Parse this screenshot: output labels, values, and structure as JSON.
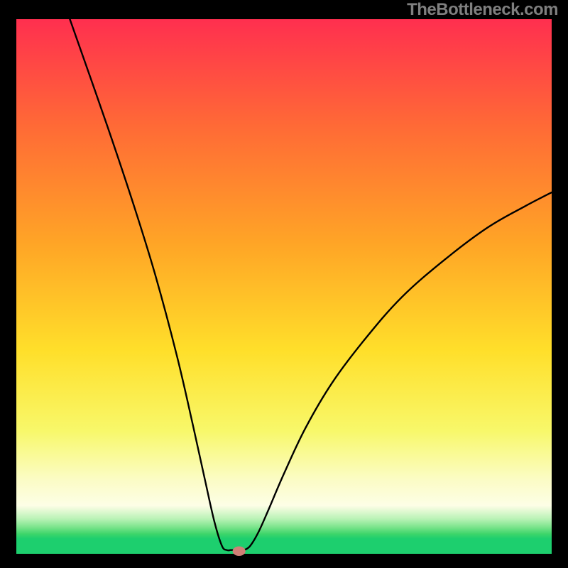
{
  "watermark": "TheBottleneck.com",
  "chart_data": {
    "type": "line",
    "title": "",
    "xlabel": "",
    "ylabel": "",
    "x_range": [
      0,
      100
    ],
    "y_range": [
      0,
      100
    ],
    "curve_left": {
      "x": [
        10,
        17,
        22,
        26,
        30,
        33,
        35.2,
        37,
        38.4,
        39.3,
        40
      ],
      "y": [
        100,
        80,
        65,
        52,
        37,
        24,
        14,
        6,
        1.5,
        0.7,
        0.7
      ]
    },
    "curve_right": {
      "x": [
        42.6,
        43.7,
        45.2,
        47,
        50,
        54,
        59,
        65,
        72,
        80,
        88,
        95,
        100
      ],
      "y": [
        0.7,
        1.5,
        4,
        8,
        15,
        23.5,
        32,
        40,
        48,
        55,
        61,
        65,
        67.6
      ]
    },
    "plateau": {
      "x1": 40,
      "x2": 42.6,
      "y": 0.7
    },
    "marker": {
      "x": 41.6,
      "y": 0.5,
      "rx": 1.2,
      "ry": 0.9,
      "color": "#d28077"
    },
    "gradient_stops": [
      {
        "offset": 0,
        "color": "#ff2f4f"
      },
      {
        "offset": 20,
        "color": "#ff6a36"
      },
      {
        "offset": 42,
        "color": "#ffa526"
      },
      {
        "offset": 62,
        "color": "#ffdf2a"
      },
      {
        "offset": 77,
        "color": "#f8f86a"
      },
      {
        "offset": 86,
        "color": "#fbfcc4"
      },
      {
        "offset": 91,
        "color": "#fdfee6"
      },
      {
        "offset": 93.5,
        "color": "#b8f2b5"
      },
      {
        "offset": 95,
        "color": "#7be48c"
      },
      {
        "offset": 96.3,
        "color": "#3dd56a"
      },
      {
        "offset": 97.2,
        "color": "#1dcf6e"
      },
      {
        "offset": 100,
        "color": "#1dcf6e"
      }
    ],
    "frame_color": "#000000",
    "curve_color": "#000000",
    "curve_width": 2.4
  }
}
